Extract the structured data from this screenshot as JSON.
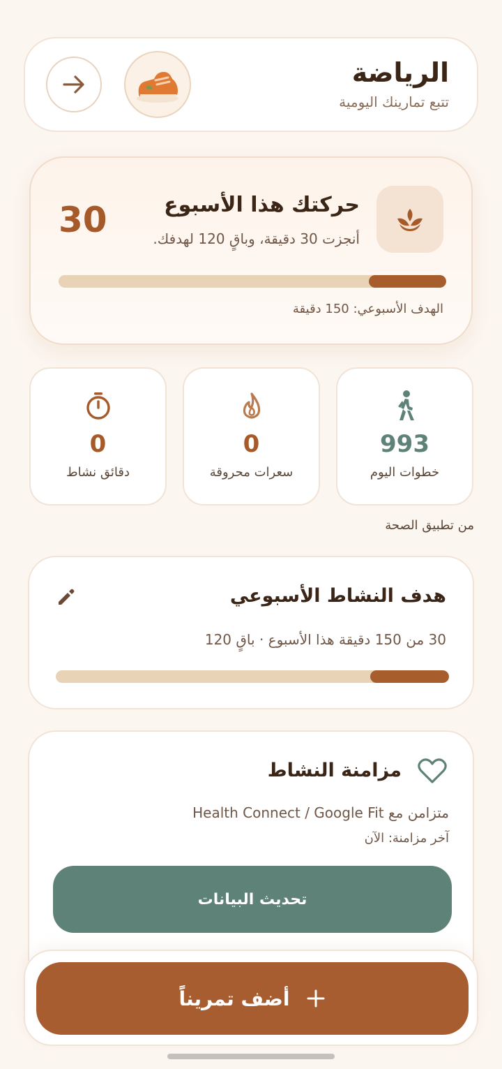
{
  "header": {
    "title": "الرياضة",
    "subtitle": "تتبع تمارينك اليومية"
  },
  "weekly": {
    "title": "حركتك هذا الأسبوع",
    "subtitle": "أنجزت 30 دقيقة، وباقٍ 120 لهدفك.",
    "minutes": "30",
    "goal_label": "الهدف الأسبوعي: 150 دقيقة",
    "progress_fraction": 0.2
  },
  "stats": [
    {
      "value": "993",
      "label": "خطوات اليوم",
      "icon": "walking-icon",
      "color": "#5f8278"
    },
    {
      "value": "0",
      "label": "سعرات محروقة",
      "icon": "flame-icon",
      "color": "#a65a2a"
    },
    {
      "value": "0",
      "label": "دقائق نشاط",
      "icon": "stopwatch-icon",
      "color": "#a65a2a"
    }
  ],
  "stats_source": "من تطبيق الصحة",
  "goal": {
    "title": "هدف النشاط الأسبوعي",
    "summary": "30 من 150 دقيقة هذا الأسبوع · باقٍ 120",
    "progress_fraction": 0.2
  },
  "sync": {
    "title": "مزامنة النشاط",
    "synced_with": "متزامن مع Health Connect / Google Fit",
    "last_sync": "آخر مزامنة: الآن",
    "refresh_label": "تحديث البيانات"
  },
  "add_workout": {
    "label": "أضف تمريناً",
    "icon": "plus-icon"
  },
  "colors": {
    "accent": "#a75d2f",
    "green": "#5f8278",
    "progress_track": "#e8d3b6"
  }
}
